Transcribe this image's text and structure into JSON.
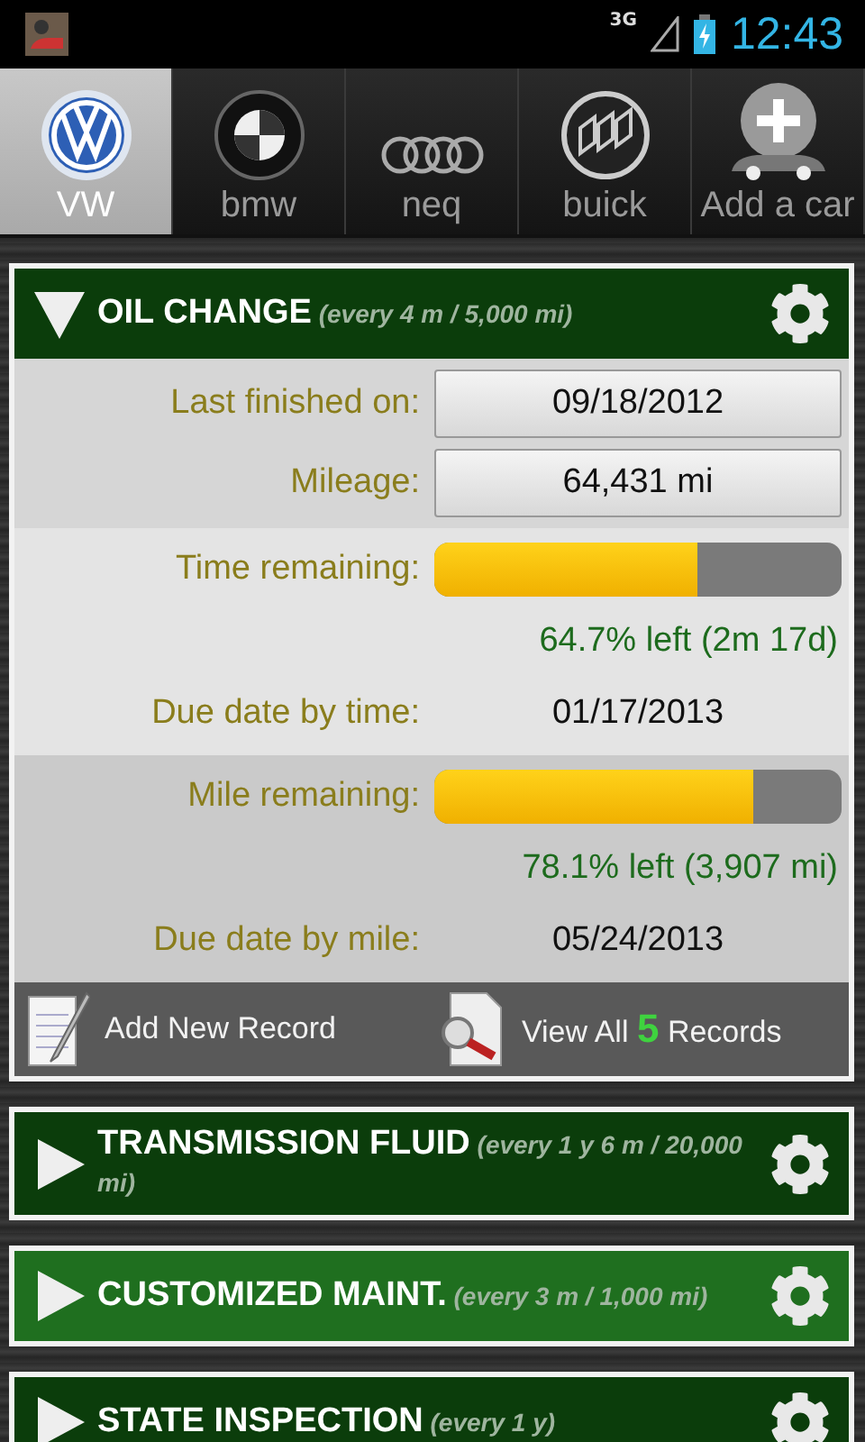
{
  "status_bar": {
    "network": "3G",
    "time": "12:43"
  },
  "tabs": [
    {
      "label": "VW",
      "kind": "vw",
      "selected": true
    },
    {
      "label": "bmw",
      "kind": "bmw",
      "selected": false
    },
    {
      "label": "neq",
      "kind": "rings",
      "selected": false
    },
    {
      "label": "buick",
      "kind": "buick",
      "selected": false
    },
    {
      "label": "Add a car",
      "kind": "add",
      "selected": false
    }
  ],
  "sections": [
    {
      "heading": "**OIL CHANGE** *(every 4 m / 5,000 mi)*",
      "expanded": true,
      "selected": false,
      "groups": [
        {
          "rows": [
            {
              "kind": "button",
              "label": "Last finished on:",
              "value": "09/18/2012"
            },
            {
              "kind": "button",
              "label": "Mileage:",
              "value": "64,431 mi"
            }
          ]
        },
        {
          "rows": [
            {
              "kind": "meter",
              "label": "Time remaining:",
              "level": 0.647,
              "note": "64.7% left (2m 17d)"
            },
            {
              "kind": "text",
              "label": "Due date by time:",
              "value": "01/17/2013"
            }
          ]
        },
        {
          "rows": [
            {
              "kind": "meter",
              "label": "Mile remaining:",
              "level": 0.781,
              "note": "78.1% left (3,907 mi)"
            },
            {
              "kind": "text",
              "label": "Due date by mile:",
              "value": "05/24/2013"
            }
          ]
        }
      ],
      "actions": {
        "add": "Add New Record",
        "view_prefix": "View All",
        "view_count": "5",
        "view_suffix": "Records"
      }
    },
    {
      "heading": "**TRANSMISSION FLUID** *(every 1 y 6 m / 20,000 mi)*",
      "expanded": false,
      "selected": false
    },
    {
      "heading": "**CUSTOMIZED MAINT.** *(every 3 m / 1,000 mi)*",
      "expanded": false,
      "selected": true
    },
    {
      "heading": "**STATE INSPECTION** *(every 1 y)*",
      "expanded": false,
      "selected": false
    }
  ]
}
